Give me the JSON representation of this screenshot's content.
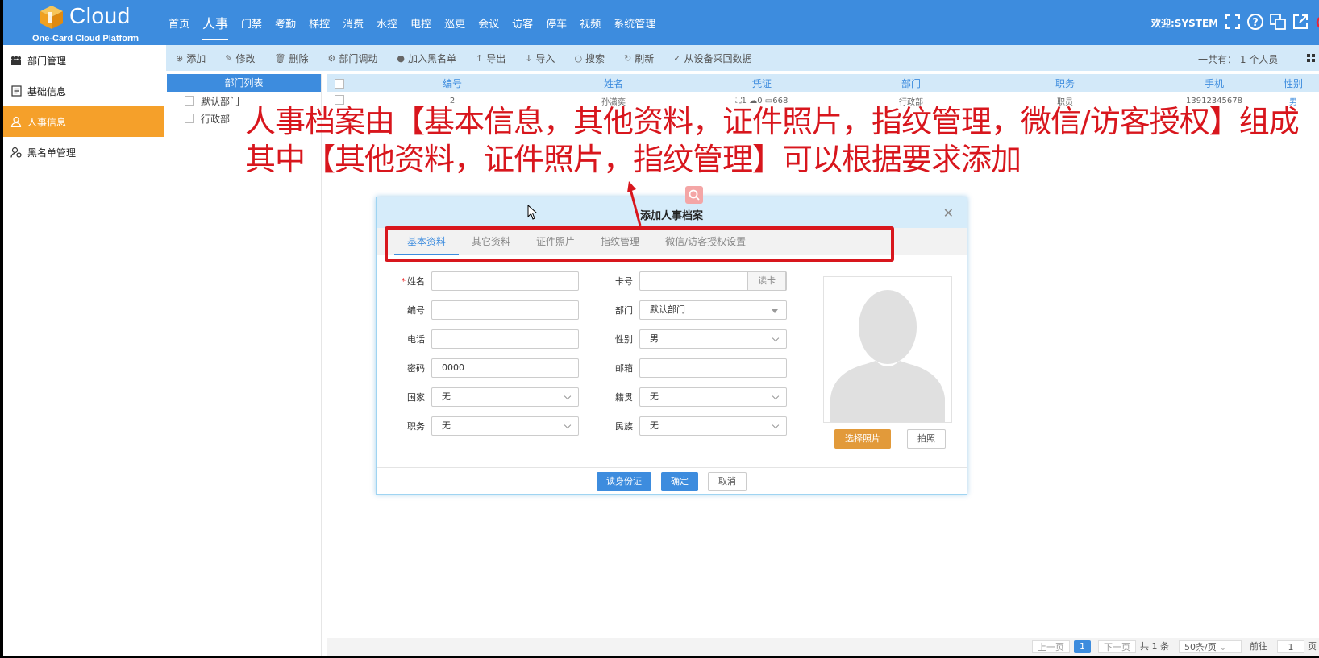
{
  "header": {
    "logo_text": "Cloud",
    "logo_sub": "One-Card Cloud Platform",
    "nav": [
      "首页",
      "人事",
      "门禁",
      "考勤",
      "梯控",
      "消费",
      "水控",
      "电控",
      "巡更",
      "会议",
      "访客",
      "停车",
      "视频",
      "系统管理"
    ],
    "active_nav": "人事",
    "welcome": "欢迎:SYSTEM",
    "brand_color": "#3d8cde"
  },
  "sidebar": {
    "items": [
      {
        "label": "部门管理",
        "icon": "org-chart-icon"
      },
      {
        "label": "基础信息",
        "icon": "document-icon"
      },
      {
        "label": "人事信息",
        "icon": "user-icon"
      },
      {
        "label": "黑名单管理",
        "icon": "blacklist-user-icon"
      }
    ],
    "active_index": 2,
    "active_color": "#f5a02a"
  },
  "toolbar": {
    "buttons": [
      "添加",
      "修改",
      "删除",
      "部门调动",
      "加入黑名单",
      "导出",
      "导入",
      "搜索",
      "刷新",
      "从设备采回数据"
    ],
    "total": "一共有： 1 个人员"
  },
  "dept_list": {
    "title": "部门列表",
    "items": [
      "默认部门",
      "行政部"
    ]
  },
  "table": {
    "columns": [
      "编号",
      "姓名",
      "凭证",
      "部门",
      "职务",
      "手机",
      "性别"
    ],
    "rows": [
      {
        "id": "2",
        "name": "孙潇奕",
        "cred_face": "1",
        "cred_finger": "0",
        "cred_card": "668",
        "dept": "行政部",
        "position": "职员",
        "phone": "13912345678",
        "gender": "男"
      }
    ]
  },
  "annotation": {
    "line1": "人事档案由【基本信息，其他资料，证件照片，指纹管理，微信/访客授权】组成",
    "line2": "其中【其他资料，证件照片，指纹管理】可以根据要求添加",
    "color": "#d8161d"
  },
  "modal": {
    "title": "添加人事档案",
    "tabs": [
      "基本资料",
      "其它资料",
      "证件照片",
      "指纹管理",
      "微信/访客授权设置"
    ],
    "active_tab": 0,
    "left_fields": [
      {
        "label": "姓名",
        "required": true,
        "value": "",
        "type": "text"
      },
      {
        "label": "编号",
        "required": false,
        "value": "",
        "type": "text"
      },
      {
        "label": "电话",
        "required": false,
        "value": "",
        "type": "text"
      },
      {
        "label": "密码",
        "required": false,
        "value": "0000",
        "type": "text"
      },
      {
        "label": "国家",
        "required": false,
        "value": "无",
        "type": "select"
      },
      {
        "label": "职务",
        "required": false,
        "value": "无",
        "type": "select"
      }
    ],
    "right_fields": [
      {
        "label": "卡号",
        "value": "",
        "type": "card"
      },
      {
        "label": "部门",
        "value": "默认部门",
        "type": "tree-select"
      },
      {
        "label": "性别",
        "value": "男",
        "type": "select"
      },
      {
        "label": "邮箱",
        "value": "",
        "type": "text"
      },
      {
        "label": "籍贯",
        "value": "无",
        "type": "select"
      },
      {
        "label": "民族",
        "value": "无",
        "type": "select"
      }
    ],
    "read_card": "读卡",
    "select_photo": "选择照片",
    "take_photo": "拍照",
    "footer": {
      "read_id": "读身份证",
      "confirm": "确定",
      "cancel": "取消"
    }
  },
  "pager": {
    "prev": "上一页",
    "current": "1",
    "next": "下一页",
    "total": "共 1 条",
    "page_size": "50条/页",
    "goto_label": "前往",
    "goto_value": "1",
    "page_suffix": "页"
  }
}
